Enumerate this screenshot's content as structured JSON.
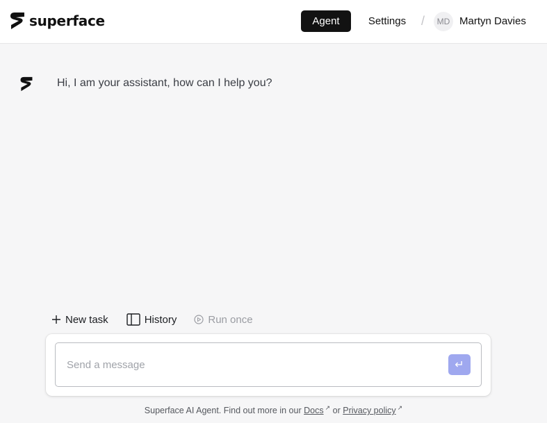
{
  "brand": {
    "name": "superface"
  },
  "nav": {
    "agent_label": "Agent",
    "settings_label": "Settings",
    "separator": "/",
    "user_initials": "MD",
    "user_name": "Martyn Davies"
  },
  "chat": {
    "assistant_message": "Hi, I am your assistant, how can I help you?"
  },
  "actions": {
    "new_task": "New task",
    "history": "History",
    "run_once": "Run once"
  },
  "composer": {
    "placeholder": "Send a message",
    "value": "",
    "send_icon": "↵"
  },
  "footer": {
    "prefix": "Superface AI Agent. Find out more in our",
    "docs_label": "Docs",
    "or": "or",
    "privacy_label": "Privacy policy",
    "external_icon": "↗"
  },
  "colors": {
    "header_bg": "#ffffff",
    "page_bg": "#f6f6f7",
    "active_nav_bg": "#121212",
    "send_button": "#9fa8ef"
  }
}
